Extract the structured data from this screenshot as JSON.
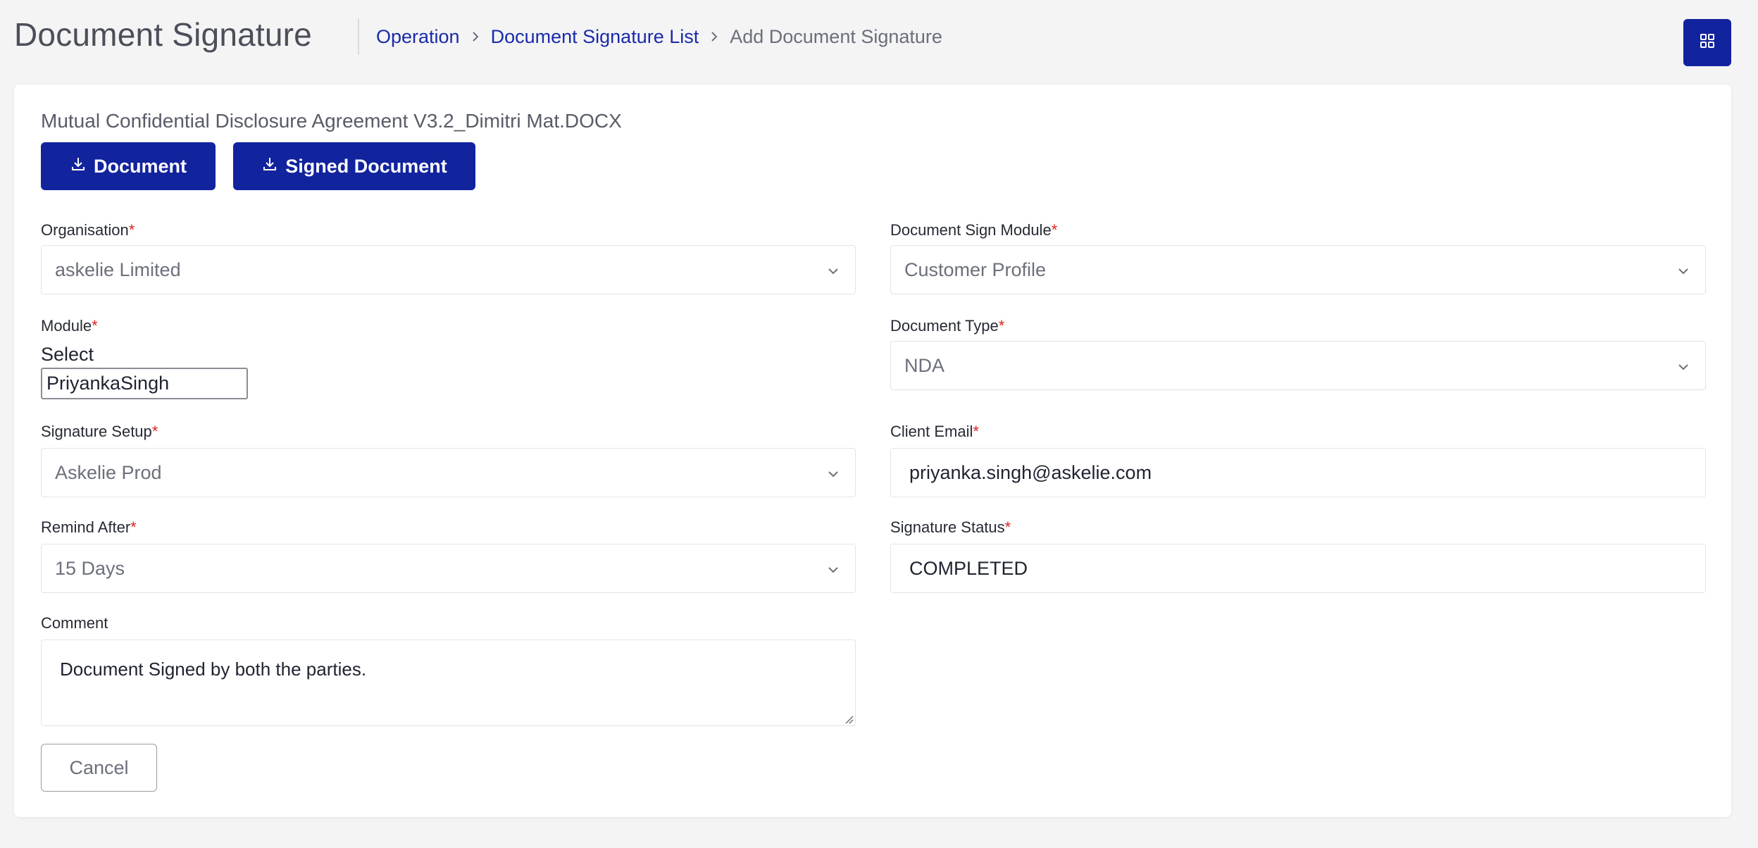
{
  "header": {
    "title": "Document Signature",
    "breadcrumb": {
      "operation": "Operation",
      "list": "Document Signature List",
      "current": "Add Document Signature"
    },
    "grid_icon": "grid-icon"
  },
  "document": {
    "file_name": "Mutual Confidential Disclosure Agreement V3.2_Dimitri Mat.DOCX",
    "download_document_label": "Document",
    "download_signed_label": "Signed Document",
    "download_icon": "download-icon"
  },
  "form": {
    "organisation": {
      "label": "Organisation",
      "required": "*",
      "value": "askelie Limited"
    },
    "document_sign_module": {
      "label": "Document Sign Module",
      "required": "*",
      "value": "Customer Profile"
    },
    "module": {
      "label": "Module",
      "required": "*",
      "select_text": "Select",
      "value": "PriyankaSingh"
    },
    "document_type": {
      "label": "Document Type",
      "required": "*",
      "value": "NDA"
    },
    "signature_setup": {
      "label": "Signature Setup",
      "required": "*",
      "value": "Askelie Prod"
    },
    "client_email": {
      "label": "Client Email",
      "required": "*",
      "value": "priyanka.singh@askelie.com"
    },
    "remind_after": {
      "label": "Remind After",
      "required": "*",
      "value": "15 Days"
    },
    "signature_status": {
      "label": "Signature Status",
      "required": "*",
      "value": "COMPLETED"
    },
    "comment": {
      "label": "Comment",
      "value": "Document Signed by both the parties."
    },
    "cancel_label": "Cancel"
  },
  "colors": {
    "primary": "#12239e",
    "link": "#1a2ba8",
    "required": "#e02020",
    "background": "#f4f4f5"
  }
}
